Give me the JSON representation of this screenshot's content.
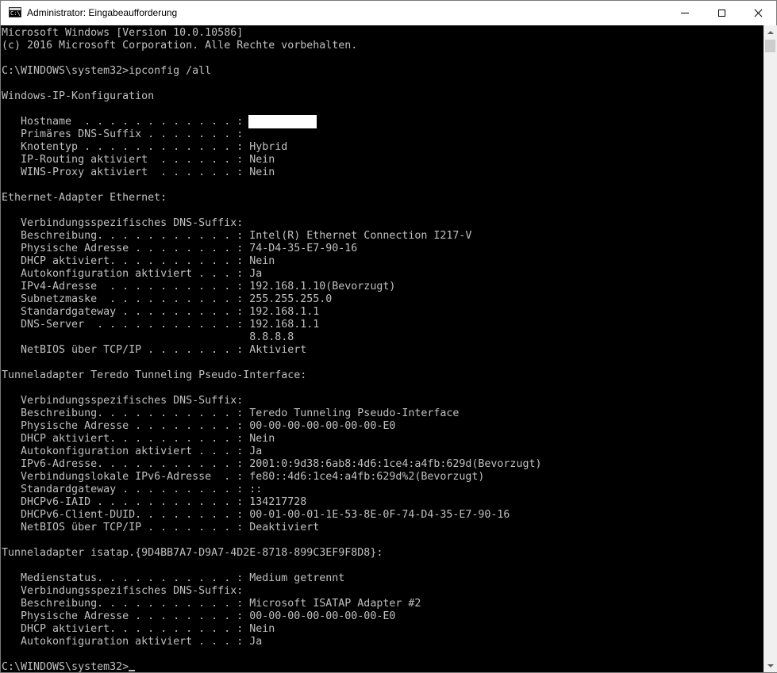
{
  "window": {
    "title": "Administrator: Eingabeaufforderung",
    "icon": "cmd-icon",
    "icon_glyph": "C:\\"
  },
  "console": {
    "lines": [
      "Microsoft Windows [Version 10.0.10586]",
      "(c) 2016 Microsoft Corporation. Alle Rechte vorbehalten.",
      "",
      "C:\\WINDOWS\\system32>ipconfig /all",
      "",
      "Windows-IP-Konfiguration",
      "",
      "   Hostname  . . . . . . . . . . . . :",
      "   Primäres DNS-Suffix . . . . . . . :",
      "   Knotentyp . . . . . . . . . . . . : Hybrid",
      "   IP-Routing aktiviert  . . . . . . : Nein",
      "   WINS-Proxy aktiviert  . . . . . . : Nein",
      "",
      "Ethernet-Adapter Ethernet:",
      "",
      "   Verbindungsspezifisches DNS-Suffix:",
      "   Beschreibung. . . . . . . . . . . : Intel(R) Ethernet Connection I217-V",
      "   Physische Adresse . . . . . . . . : 74-D4-35-E7-90-16",
      "   DHCP aktiviert. . . . . . . . . . : Nein",
      "   Autokonfiguration aktiviert . . . : Ja",
      "   IPv4-Adresse  . . . . . . . . . . : 192.168.1.10(Bevorzugt)",
      "   Subnetzmaske  . . . . . . . . . . : 255.255.255.0",
      "   Standardgateway . . . . . . . . . : 192.168.1.1",
      "   DNS-Server  . . . . . . . . . . . : 192.168.1.1",
      "                                       8.8.8.8",
      "   NetBIOS über TCP/IP . . . . . . . : Aktiviert",
      "",
      "Tunneladapter Teredo Tunneling Pseudo-Interface:",
      "",
      "   Verbindungsspezifisches DNS-Suffix:",
      "   Beschreibung. . . . . . . . . . . : Teredo Tunneling Pseudo-Interface",
      "   Physische Adresse . . . . . . . . : 00-00-00-00-00-00-00-E0",
      "   DHCP aktiviert. . . . . . . . . . : Nein",
      "   Autokonfiguration aktiviert . . . : Ja",
      "   IPv6-Adresse. . . . . . . . . . . : 2001:0:9d38:6ab8:4d6:1ce4:a4fb:629d(Bevorzugt)",
      "   Verbindungslokale IPv6-Adresse  . : fe80::4d6:1ce4:a4fb:629d%2(Bevorzugt)",
      "   Standardgateway . . . . . . . . . : ::",
      "   DHCPv6-IAID . . . . . . . . . . . : 134217728",
      "   DHCPv6-Client-DUID. . . . . . . . : 00-01-00-01-1E-53-8E-0F-74-D4-35-E7-90-16",
      "   NetBIOS über TCP/IP . . . . . . . : Deaktiviert",
      "",
      "Tunneladapter isatap.{9D4BB7A7-D9A7-4D2E-8718-899C3EF9F8D8}:",
      "",
      "   Medienstatus. . . . . . . . . . . : Medium getrennt",
      "   Verbindungsspezifisches DNS-Suffix:",
      "   Beschreibung. . . . . . . . . . . : Microsoft ISATAP Adapter #2",
      "   Physische Adresse . . . . . . . . : 00-00-00-00-00-00-00-E0",
      "   DHCP aktiviert. . . . . . . . . . : Nein",
      "   Autokonfiguration aktiviert . . . : Ja",
      "",
      "C:\\WINDOWS\\system32>"
    ]
  },
  "colors": {
    "console_background": "#000000",
    "console_text": "#c0c0c0",
    "titlebar": "#ffffff"
  }
}
